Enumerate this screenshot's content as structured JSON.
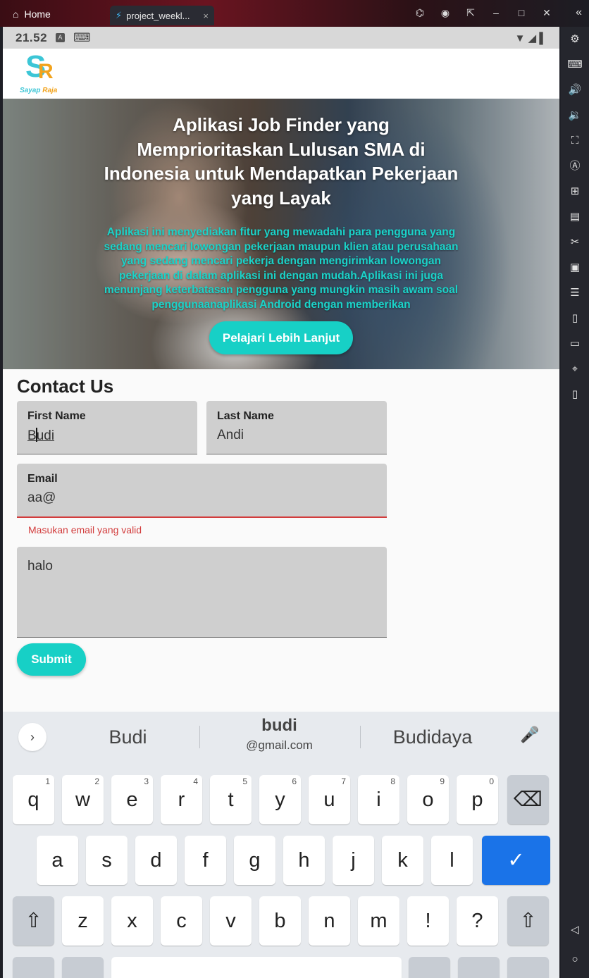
{
  "window": {
    "home_label": "Home",
    "tab_label": "project_weekl...",
    "tab_close": "×",
    "controls": [
      "🎮",
      "◉",
      "↗",
      "—",
      "□",
      "✕"
    ],
    "collapse": "«"
  },
  "status": {
    "time": "21.52",
    "badge1": "A",
    "badge2": "⌨",
    "icons": "▼ ◢ ▌"
  },
  "app": {
    "logo_s": "S",
    "logo_r": "R",
    "logo_text_1": "Sayap",
    "logo_text_2": "Raja"
  },
  "hero": {
    "title": "Aplikasi Job Finder yang Memprioritaskan Lulusan SMA di Indonesia untuk Mendapatkan Pekerjaan yang Layak",
    "description": "Aplikasi ini menyediakan fitur yang mewadahi para pengguna yang sedang mencari lowongan pekerjaan maupun klien atau perusahaan yang sedang mencari pekerja dengan mengirimkan lowongan pekerjaan di dalam aplikasi ini dengan mudah.Aplikasi ini juga menunjang keterbatasan pengguna yang mungkin masih awam soal penggunaanaplikasi Android dengan memberikan",
    "button": "Pelajari Lebih Lanjut"
  },
  "contact": {
    "title": "Contact Us",
    "first_name": {
      "label": "First Name",
      "value_pre": "B",
      "value_post": "udi"
    },
    "last_name": {
      "label": "Last Name",
      "value": "Andi"
    },
    "email": {
      "label": "Email",
      "value": "aa@",
      "error": "Masukan email yang valid"
    },
    "message": {
      "value": "halo"
    },
    "submit": "Submit"
  },
  "keyboard": {
    "suggestions": [
      "Budi",
      "budi",
      "@gmail.com",
      "Budidaya"
    ],
    "row1": [
      [
        "q",
        "1"
      ],
      [
        "w",
        "2"
      ],
      [
        "e",
        "3"
      ],
      [
        "r",
        "4"
      ],
      [
        "t",
        "5"
      ],
      [
        "y",
        "6"
      ],
      [
        "u",
        "7"
      ],
      [
        "i",
        "8"
      ],
      [
        "o",
        "9"
      ],
      [
        "p",
        "0"
      ]
    ],
    "row2": [
      "a",
      "s",
      "d",
      "f",
      "g",
      "h",
      "j",
      "k",
      "l"
    ],
    "row3": [
      "z",
      "x",
      "c",
      "v",
      "b",
      "n",
      "m",
      "!",
      "?"
    ],
    "backspace": "⌫",
    "enter": "✓",
    "shift": "⇧",
    "expand": "›",
    "mic": "🎙"
  },
  "sidebar_icons": [
    "settings-icon",
    "keyboard-icon",
    "volume-up-icon",
    "volume-down-icon",
    "screenshot-icon",
    "auto-icon",
    "add-app-icon",
    "apk-icon",
    "cut-icon",
    "multi-instance-icon",
    "sync-icon",
    "shake-icon",
    "folder-icon",
    "location-icon",
    "rotate-icon",
    "back-icon",
    "home-icon"
  ]
}
